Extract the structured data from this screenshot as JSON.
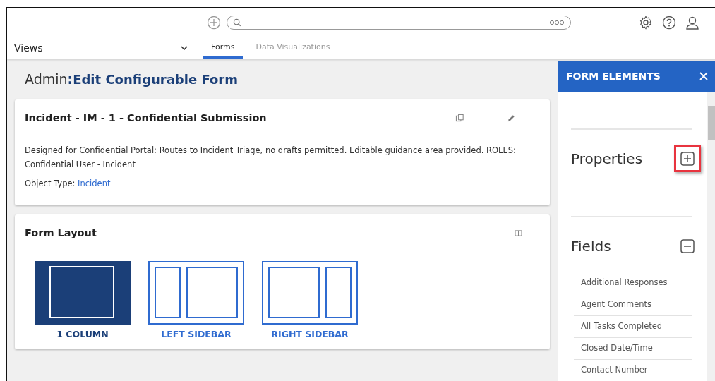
{
  "nav": {
    "views_label": "Views",
    "tabs": [
      {
        "label": "Forms",
        "selected": true
      },
      {
        "label": "Data Visualizations",
        "selected": false
      }
    ]
  },
  "page_title": {
    "prefix": "Admin",
    "separator": ":",
    "title": "Edit Configurable Form"
  },
  "form_card": {
    "title": "Incident - IM - 1 - Confidential Submission",
    "description": "Designed for Confidential Portal: Routes to Incident Triage, no drafts permitted. Editable guidance area provided. ROLES: Confidential User - Incident",
    "object_type_label": "Object Type:",
    "object_type": "Incident"
  },
  "layout_card": {
    "title": "Form Layout",
    "options": [
      {
        "label": "1 COLUMN",
        "kind": "single",
        "selected": true
      },
      {
        "label": "LEFT SIDEBAR",
        "kind": "left",
        "selected": false
      },
      {
        "label": "RIGHT SIDEBAR",
        "kind": "right",
        "selected": false
      }
    ]
  },
  "panel": {
    "title": "FORM ELEMENTS",
    "sections": [
      {
        "title": "Properties",
        "expanded": false,
        "highlighted": true
      },
      {
        "title": "Fields",
        "expanded": true,
        "highlighted": false,
        "items": [
          "Additional Responses",
          "Agent Comments",
          "All Tasks Completed",
          "Closed Date/Time",
          "Contact Number"
        ]
      }
    ]
  }
}
